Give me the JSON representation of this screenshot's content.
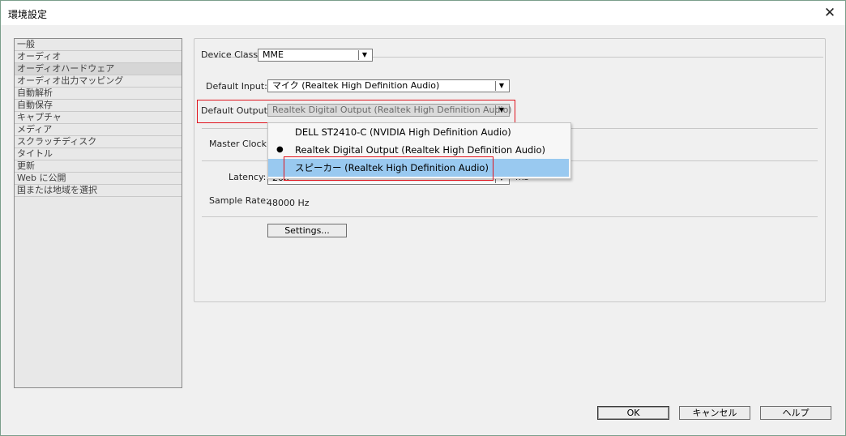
{
  "window": {
    "title": "環境設定",
    "close_glyph": "✕"
  },
  "sidebar": {
    "items": [
      {
        "label": "一般"
      },
      {
        "label": "オーディオ"
      },
      {
        "label": "オーディオハードウェア"
      },
      {
        "label": "オーディオ出力マッピング"
      },
      {
        "label": "自動解析"
      },
      {
        "label": "自動保存"
      },
      {
        "label": "キャプチャ"
      },
      {
        "label": "メディア"
      },
      {
        "label": "スクラッチディスク"
      },
      {
        "label": "タイトル"
      },
      {
        "label": "更新"
      },
      {
        "label": "Web に公開"
      },
      {
        "label": "国または地域を選択"
      }
    ],
    "selected": "オーディオハードウェア"
  },
  "form": {
    "device_class": {
      "label": "Device Class:",
      "value": "MME"
    },
    "default_input": {
      "label": "Default Input:",
      "value": "マイク (Realtek High Definition Audio)"
    },
    "default_output": {
      "label": "Default Output:",
      "value": "Realtek Digital Output (Realtek High Definition Audio)"
    },
    "master_clock": {
      "label": "Master Clock:",
      "value": ""
    },
    "latency": {
      "label": "Latency:",
      "value": "200",
      "unit": "ms"
    },
    "sample_rate": {
      "label": "Sample Rate:",
      "value": "48000 Hz"
    },
    "settings_button": "Settings..."
  },
  "dropdown": {
    "options": [
      {
        "label": "DELL ST2410-C (NVIDIA High Definition Audio)"
      },
      {
        "label": "Realtek Digital Output (Realtek High Definition Audio)"
      },
      {
        "label": "スピーカー (Realtek High Definition Audio)"
      }
    ],
    "checked_index": 1,
    "highlighted_index": 2,
    "bullet_glyph": "●"
  },
  "buttons": {
    "ok": "OK",
    "cancel": "キャンセル",
    "help": "ヘルプ"
  },
  "colors": {
    "highlight_box": "#e0141e",
    "selected_option_bg": "#99c9f0"
  }
}
